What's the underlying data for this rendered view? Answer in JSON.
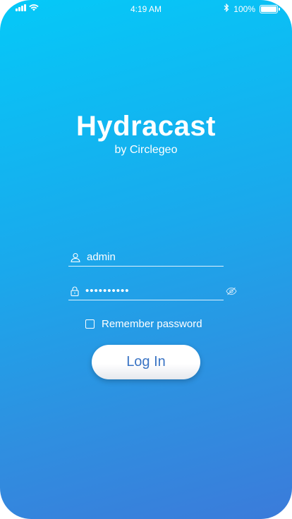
{
  "status_bar": {
    "time": "4:19 AM",
    "battery_percent": "100%",
    "battery_level": 1.0,
    "icons": [
      "signal-icon",
      "wifi-icon",
      "bluetooth-icon",
      "battery-icon"
    ]
  },
  "brand": {
    "title": "Hydracast",
    "subtitle": "by Circlegeo"
  },
  "login_form": {
    "username_value": "admin",
    "password_value": "••••••••••",
    "remember_label": "Remember password",
    "remember_checked": false,
    "login_label": "Log In"
  },
  "colors": {
    "gradient_top": "#05c9f8",
    "gradient_bottom": "#3b7bda",
    "button_text": "#3a74c4",
    "text": "#ffffff"
  }
}
